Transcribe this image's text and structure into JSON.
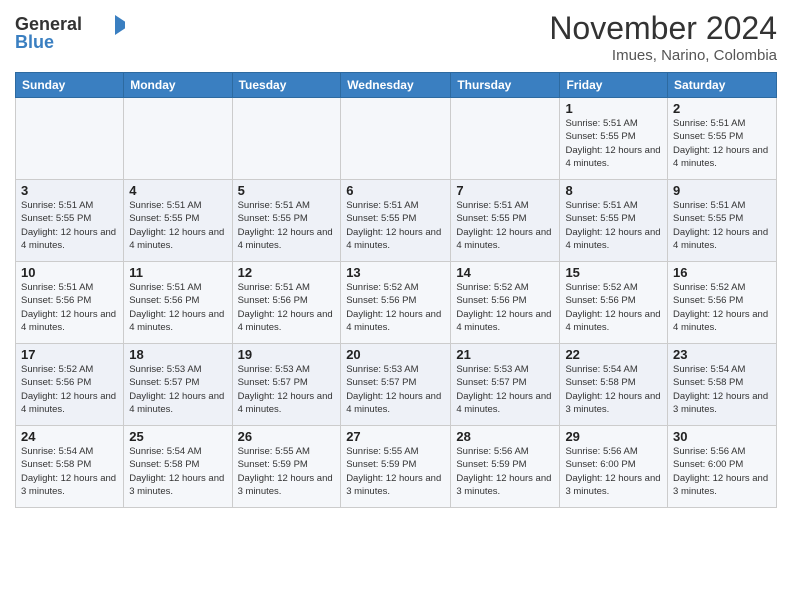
{
  "header": {
    "logo": {
      "general": "General",
      "blue": "Blue"
    },
    "title": "November 2024",
    "location": "Imues, Narino, Colombia"
  },
  "days_of_week": [
    "Sunday",
    "Monday",
    "Tuesday",
    "Wednesday",
    "Thursday",
    "Friday",
    "Saturday"
  ],
  "weeks": [
    [
      {
        "day": "",
        "info": ""
      },
      {
        "day": "",
        "info": ""
      },
      {
        "day": "",
        "info": ""
      },
      {
        "day": "",
        "info": ""
      },
      {
        "day": "",
        "info": ""
      },
      {
        "day": "1",
        "info": "Sunrise: 5:51 AM\nSunset: 5:55 PM\nDaylight: 12 hours and 4 minutes."
      },
      {
        "day": "2",
        "info": "Sunrise: 5:51 AM\nSunset: 5:55 PM\nDaylight: 12 hours and 4 minutes."
      }
    ],
    [
      {
        "day": "3",
        "info": "Sunrise: 5:51 AM\nSunset: 5:55 PM\nDaylight: 12 hours and 4 minutes."
      },
      {
        "day": "4",
        "info": "Sunrise: 5:51 AM\nSunset: 5:55 PM\nDaylight: 12 hours and 4 minutes."
      },
      {
        "day": "5",
        "info": "Sunrise: 5:51 AM\nSunset: 5:55 PM\nDaylight: 12 hours and 4 minutes."
      },
      {
        "day": "6",
        "info": "Sunrise: 5:51 AM\nSunset: 5:55 PM\nDaylight: 12 hours and 4 minutes."
      },
      {
        "day": "7",
        "info": "Sunrise: 5:51 AM\nSunset: 5:55 PM\nDaylight: 12 hours and 4 minutes."
      },
      {
        "day": "8",
        "info": "Sunrise: 5:51 AM\nSunset: 5:55 PM\nDaylight: 12 hours and 4 minutes."
      },
      {
        "day": "9",
        "info": "Sunrise: 5:51 AM\nSunset: 5:55 PM\nDaylight: 12 hours and 4 minutes."
      }
    ],
    [
      {
        "day": "10",
        "info": "Sunrise: 5:51 AM\nSunset: 5:56 PM\nDaylight: 12 hours and 4 minutes."
      },
      {
        "day": "11",
        "info": "Sunrise: 5:51 AM\nSunset: 5:56 PM\nDaylight: 12 hours and 4 minutes."
      },
      {
        "day": "12",
        "info": "Sunrise: 5:51 AM\nSunset: 5:56 PM\nDaylight: 12 hours and 4 minutes."
      },
      {
        "day": "13",
        "info": "Sunrise: 5:52 AM\nSunset: 5:56 PM\nDaylight: 12 hours and 4 minutes."
      },
      {
        "day": "14",
        "info": "Sunrise: 5:52 AM\nSunset: 5:56 PM\nDaylight: 12 hours and 4 minutes."
      },
      {
        "day": "15",
        "info": "Sunrise: 5:52 AM\nSunset: 5:56 PM\nDaylight: 12 hours and 4 minutes."
      },
      {
        "day": "16",
        "info": "Sunrise: 5:52 AM\nSunset: 5:56 PM\nDaylight: 12 hours and 4 minutes."
      }
    ],
    [
      {
        "day": "17",
        "info": "Sunrise: 5:52 AM\nSunset: 5:56 PM\nDaylight: 12 hours and 4 minutes."
      },
      {
        "day": "18",
        "info": "Sunrise: 5:53 AM\nSunset: 5:57 PM\nDaylight: 12 hours and 4 minutes."
      },
      {
        "day": "19",
        "info": "Sunrise: 5:53 AM\nSunset: 5:57 PM\nDaylight: 12 hours and 4 minutes."
      },
      {
        "day": "20",
        "info": "Sunrise: 5:53 AM\nSunset: 5:57 PM\nDaylight: 12 hours and 4 minutes."
      },
      {
        "day": "21",
        "info": "Sunrise: 5:53 AM\nSunset: 5:57 PM\nDaylight: 12 hours and 4 minutes."
      },
      {
        "day": "22",
        "info": "Sunrise: 5:54 AM\nSunset: 5:58 PM\nDaylight: 12 hours and 3 minutes."
      },
      {
        "day": "23",
        "info": "Sunrise: 5:54 AM\nSunset: 5:58 PM\nDaylight: 12 hours and 3 minutes."
      }
    ],
    [
      {
        "day": "24",
        "info": "Sunrise: 5:54 AM\nSunset: 5:58 PM\nDaylight: 12 hours and 3 minutes."
      },
      {
        "day": "25",
        "info": "Sunrise: 5:54 AM\nSunset: 5:58 PM\nDaylight: 12 hours and 3 minutes."
      },
      {
        "day": "26",
        "info": "Sunrise: 5:55 AM\nSunset: 5:59 PM\nDaylight: 12 hours and 3 minutes."
      },
      {
        "day": "27",
        "info": "Sunrise: 5:55 AM\nSunset: 5:59 PM\nDaylight: 12 hours and 3 minutes."
      },
      {
        "day": "28",
        "info": "Sunrise: 5:56 AM\nSunset: 5:59 PM\nDaylight: 12 hours and 3 minutes."
      },
      {
        "day": "29",
        "info": "Sunrise: 5:56 AM\nSunset: 6:00 PM\nDaylight: 12 hours and 3 minutes."
      },
      {
        "day": "30",
        "info": "Sunrise: 5:56 AM\nSunset: 6:00 PM\nDaylight: 12 hours and 3 minutes."
      }
    ]
  ]
}
